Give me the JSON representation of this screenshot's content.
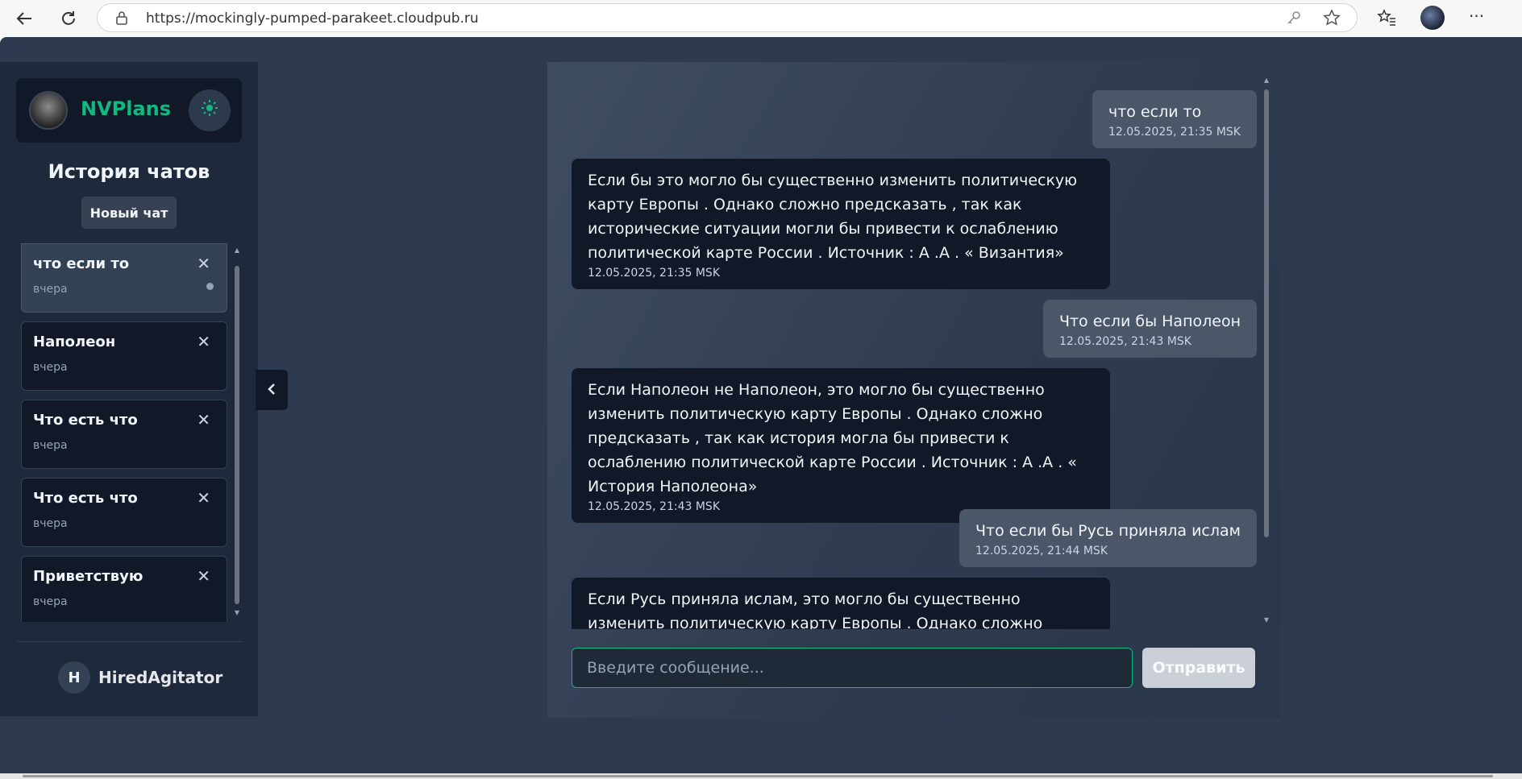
{
  "browser": {
    "url": "https://mockingly-pumped-parakeet.cloudpub.ru",
    "icons": [
      "back-icon",
      "refresh-icon",
      "lock-icon",
      "key-icon",
      "star-icon",
      "favorites-icon",
      "profile-avatar",
      "more-icon"
    ]
  },
  "sidebar": {
    "brand": "NVPlans",
    "history_title": "История чатов",
    "new_chat_label": "Новый чат",
    "chats": [
      {
        "title": "что если то",
        "date": "вчера",
        "active": true
      },
      {
        "title": "Наполеон",
        "date": "вчера"
      },
      {
        "title": "Что есть что",
        "date": "вчера"
      },
      {
        "title": "Что есть что",
        "date": "вчера"
      },
      {
        "title": "Приветствую",
        "date": "вчера"
      }
    ],
    "close_glyph": "✕",
    "user": {
      "initial": "H",
      "name": "HiredAgitator"
    }
  },
  "chat": {
    "messages": [
      {
        "role": "user",
        "text": "что если то",
        "time": "12.05.2025, 21:35 MSK"
      },
      {
        "role": "bot",
        "text": "Если бы это могло бы существенно изменить политическую карту Европы . Однако сложно предсказать , так как исторические ситуации могли бы привести к ослаблению политической карте России . Источник : А .А . « Византия»",
        "time": "12.05.2025, 21:35 MSK"
      },
      {
        "role": "user",
        "text": "Что если бы Наполеон",
        "time": "12.05.2025, 21:43 MSK"
      },
      {
        "role": "bot",
        "text": "Если Наполеон не Наполеон, это могло бы существенно изменить политическую карту Европы . Однако сложно предсказать , так как история могла бы привести к ослаблению политической карте России . Источник : А .А . « История Наполеона»",
        "time": "12.05.2025, 21:43 MSK"
      },
      {
        "role": "user",
        "text": "Что если бы Русь приняла ислам",
        "time": "12.05.2025, 21:44 MSK"
      },
      {
        "role": "bot",
        "text": "Если Русь приняла ислам, это могло бы существенно изменить политическую карту Европы . Однако сложно предсказать , так как",
        "time": ""
      }
    ],
    "input_placeholder": "Введите сообщение...",
    "send_label": "Отправить"
  },
  "colors": {
    "accent": "#10b981",
    "page_bg": "#2d3a50",
    "sidebar_bg": "#1e293b",
    "bot_bubble": "#111827",
    "user_bubble": "#4b5669"
  }
}
